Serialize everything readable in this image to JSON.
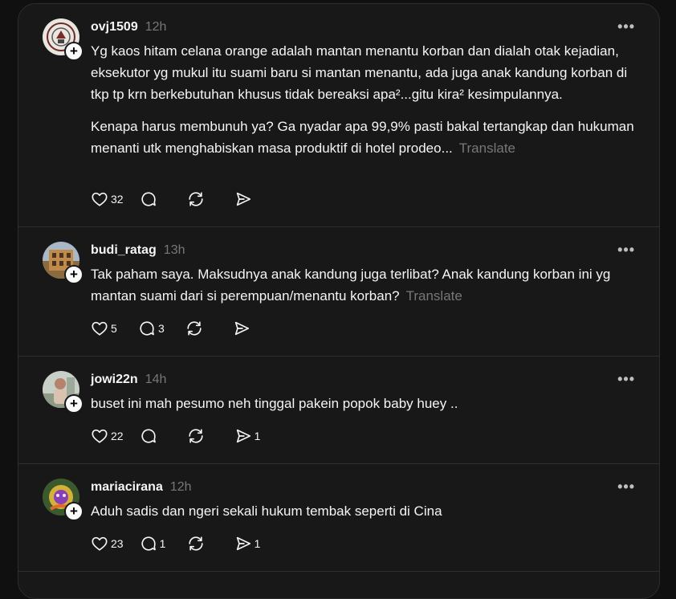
{
  "posts": [
    {
      "username": "ovj1509",
      "time": "12h",
      "more": "•••",
      "paragraphs": [
        "Yg kaos hitam celana orange adalah mantan menantu korban dan dialah otak kejadian, eksekutor yg mukul itu suami baru si mantan menantu, ada juga anak kandung korban di tkp tp krn berkebutuhan khusus tidak bereaksi apa²...gitu kira² kesimpulannya.",
        "Kenapa harus membunuh ya? Ga nyadar apa 99,9% pasti bakal tertangkap dan hukuman menanti utk menghabiskan masa produktif di hotel prodeo..."
      ],
      "translate": "Translate",
      "likes": "32",
      "replies": "",
      "shares": ""
    },
    {
      "username": "budi_ratag",
      "time": "13h",
      "more": "•••",
      "paragraphs": [
        "Tak paham saya. Maksudnya anak kandung juga terlibat? Anak kandung korban ini yg mantan suami dari si perempuan/menantu korban?"
      ],
      "translate": "Translate",
      "likes": "5",
      "replies": "3",
      "shares": ""
    },
    {
      "username": "jowi22n",
      "time": "14h",
      "more": "•••",
      "paragraphs": [
        "buset ini mah pesumo neh tinggal pakein popok baby huey .."
      ],
      "translate": "",
      "likes": "22",
      "replies": "",
      "shares": "1"
    },
    {
      "username": "mariacirana",
      "time": "12h",
      "more": "•••",
      "paragraphs": [
        "Aduh sadis dan ngeri sekali hukum tembak seperti di Cina"
      ],
      "translate": "",
      "likes": "23",
      "replies": "1",
      "shares": "1"
    }
  ],
  "colors": {
    "background": "#101010",
    "panel": "#181818",
    "text": "#f3f5f7",
    "muted": "#777777",
    "divider": "#2f2f2f"
  },
  "icons": [
    "heart-icon",
    "reply-icon",
    "repost-icon",
    "share-icon",
    "more-icon",
    "follow-plus-icon"
  ]
}
